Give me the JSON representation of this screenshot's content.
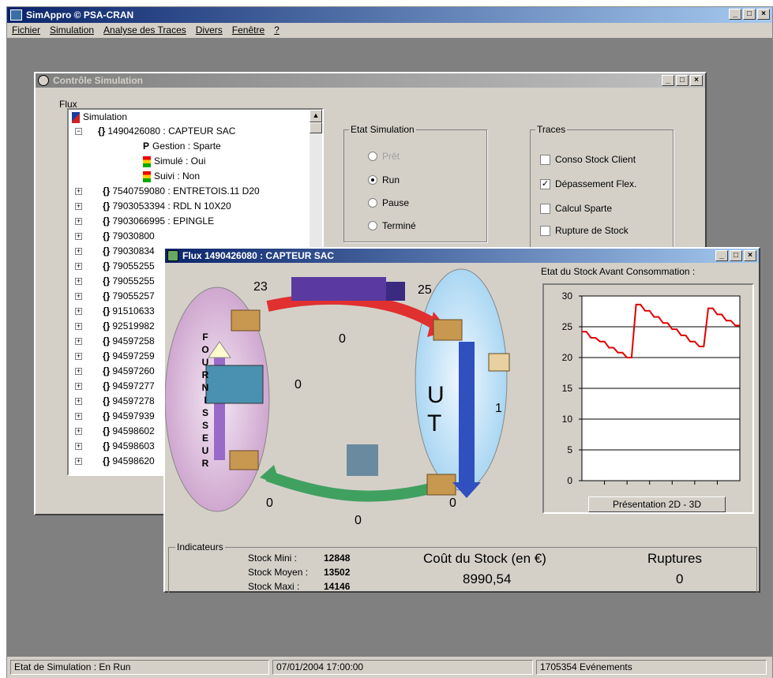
{
  "app": {
    "title": "SimAppro © PSA-CRAN"
  },
  "menu": [
    "Fichier",
    "Simulation",
    "Analyse des Traces",
    "Divers",
    "Fenêtre",
    "?"
  ],
  "control_window": {
    "title": "Contrôle Simulation",
    "flux_label": "Flux",
    "tree": {
      "root": "Simulation",
      "expanded_node": "1490426080 : CAPTEUR SAC",
      "details": [
        "Gestion : Sparte",
        "Simulé : Oui",
        "Suivi : Non"
      ],
      "nodes": [
        "7540759080 : ENTRETOIS.11 D20",
        "7903053394 : RDL N 10X20",
        "7903066995 : EPINGLE",
        "79030800",
        "79030834",
        "79055255",
        "79055255",
        "79055257",
        "91510633",
        "92519982",
        "94597258",
        "94597259",
        "94597260",
        "94597277",
        "94597278",
        "94597939",
        "94598602",
        "94598603",
        "94598620"
      ]
    },
    "etat": {
      "legend": "Etat Simulation",
      "options": [
        {
          "label": "Prêt",
          "selected": false,
          "disabled": true
        },
        {
          "label": "Run",
          "selected": true,
          "disabled": false
        },
        {
          "label": "Pause",
          "selected": false,
          "disabled": false
        },
        {
          "label": "Terminé",
          "selected": false,
          "disabled": false
        }
      ]
    },
    "traces": {
      "legend": "Traces",
      "options": [
        {
          "label": "Conso Stock Client",
          "checked": false
        },
        {
          "label": "Dépassement Flex.",
          "checked": true
        },
        {
          "label": "Calcul Sparte",
          "checked": false
        },
        {
          "label": "Rupture de Stock",
          "checked": false
        }
      ]
    }
  },
  "flux_window": {
    "title": "Flux 1490426080 : CAPTEUR SAC",
    "fournisseur_letters": [
      "F",
      "O",
      "U",
      "R",
      "N",
      "I",
      "S",
      "S",
      "E",
      "U",
      "R"
    ],
    "ut_letters": [
      "U",
      "T"
    ],
    "numbers": {
      "top_left": "23",
      "top_right": "25",
      "center_top": "0",
      "left_mid": "0",
      "right_mid": "1",
      "bottom_left": "0",
      "bottom_center": "0",
      "bottom_right": "0"
    },
    "chart_title": "Etat du Stock Avant Consommation :",
    "toggle_button": "Présentation 2D - 3D",
    "indicators": {
      "legend": "Indicateurs",
      "stock_mini_label": "Stock Mini :",
      "stock_mini": "12848",
      "stock_moyen_label": "Stock Moyen :",
      "stock_moyen": "13502",
      "stock_maxi_label": "Stock Maxi :",
      "stock_maxi": "14146",
      "cost_label": "Coût du Stock (en €)",
      "cost_value": "8990,54",
      "ruptures_label": "Ruptures",
      "ruptures_value": "0"
    }
  },
  "status": {
    "state": "Etat de Simulation : En Run",
    "datetime": "07/01/2004 17:00:00",
    "events": "1705354 Evénements"
  },
  "chart_data": {
    "type": "line",
    "title": "Etat du Stock Avant Consommation :",
    "xlabel": "",
    "ylabel": "",
    "ylim": [
      0,
      30
    ],
    "yticks": [
      0,
      5,
      10,
      15,
      20,
      25,
      30
    ],
    "grid": true,
    "series": [
      {
        "color": "#e00000",
        "values": [
          24.2,
          24.2,
          23.2,
          23.2,
          22.6,
          22.6,
          21.6,
          21.6,
          20.8,
          20.8,
          20,
          20,
          28.6,
          28.6,
          27.6,
          27.6,
          26.6,
          26.6,
          25.6,
          25.6,
          24.6,
          24.6,
          23.6,
          23.6,
          22.6,
          22.6,
          21.8,
          21.8,
          28,
          28,
          27,
          27,
          26,
          26,
          25.2,
          25.2
        ]
      }
    ]
  }
}
